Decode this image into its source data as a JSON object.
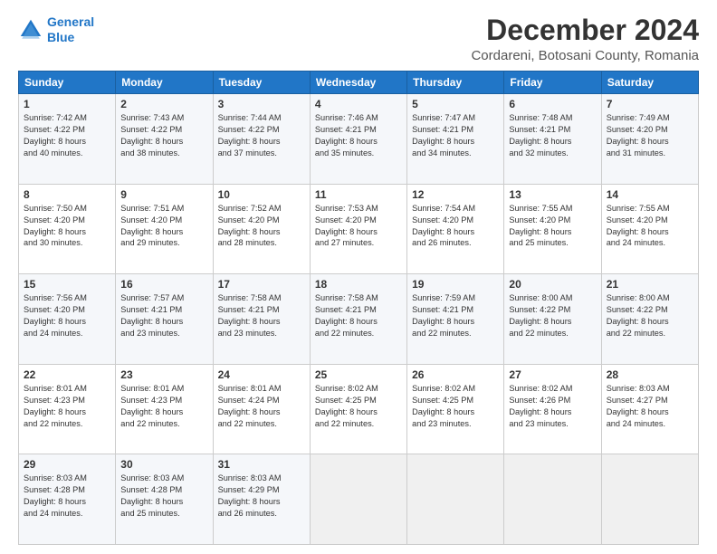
{
  "logo": {
    "line1": "General",
    "line2": "Blue"
  },
  "title": "December 2024",
  "subtitle": "Cordareni, Botosani County, Romania",
  "headers": [
    "Sunday",
    "Monday",
    "Tuesday",
    "Wednesday",
    "Thursday",
    "Friday",
    "Saturday"
  ],
  "weeks": [
    [
      {
        "day": "1",
        "info": "Sunrise: 7:42 AM\nSunset: 4:22 PM\nDaylight: 8 hours\nand 40 minutes."
      },
      {
        "day": "2",
        "info": "Sunrise: 7:43 AM\nSunset: 4:22 PM\nDaylight: 8 hours\nand 38 minutes."
      },
      {
        "day": "3",
        "info": "Sunrise: 7:44 AM\nSunset: 4:22 PM\nDaylight: 8 hours\nand 37 minutes."
      },
      {
        "day": "4",
        "info": "Sunrise: 7:46 AM\nSunset: 4:21 PM\nDaylight: 8 hours\nand 35 minutes."
      },
      {
        "day": "5",
        "info": "Sunrise: 7:47 AM\nSunset: 4:21 PM\nDaylight: 8 hours\nand 34 minutes."
      },
      {
        "day": "6",
        "info": "Sunrise: 7:48 AM\nSunset: 4:21 PM\nDaylight: 8 hours\nand 32 minutes."
      },
      {
        "day": "7",
        "info": "Sunrise: 7:49 AM\nSunset: 4:20 PM\nDaylight: 8 hours\nand 31 minutes."
      }
    ],
    [
      {
        "day": "8",
        "info": "Sunrise: 7:50 AM\nSunset: 4:20 PM\nDaylight: 8 hours\nand 30 minutes."
      },
      {
        "day": "9",
        "info": "Sunrise: 7:51 AM\nSunset: 4:20 PM\nDaylight: 8 hours\nand 29 minutes."
      },
      {
        "day": "10",
        "info": "Sunrise: 7:52 AM\nSunset: 4:20 PM\nDaylight: 8 hours\nand 28 minutes."
      },
      {
        "day": "11",
        "info": "Sunrise: 7:53 AM\nSunset: 4:20 PM\nDaylight: 8 hours\nand 27 minutes."
      },
      {
        "day": "12",
        "info": "Sunrise: 7:54 AM\nSunset: 4:20 PM\nDaylight: 8 hours\nand 26 minutes."
      },
      {
        "day": "13",
        "info": "Sunrise: 7:55 AM\nSunset: 4:20 PM\nDaylight: 8 hours\nand 25 minutes."
      },
      {
        "day": "14",
        "info": "Sunrise: 7:55 AM\nSunset: 4:20 PM\nDaylight: 8 hours\nand 24 minutes."
      }
    ],
    [
      {
        "day": "15",
        "info": "Sunrise: 7:56 AM\nSunset: 4:20 PM\nDaylight: 8 hours\nand 24 minutes."
      },
      {
        "day": "16",
        "info": "Sunrise: 7:57 AM\nSunset: 4:21 PM\nDaylight: 8 hours\nand 23 minutes."
      },
      {
        "day": "17",
        "info": "Sunrise: 7:58 AM\nSunset: 4:21 PM\nDaylight: 8 hours\nand 23 minutes."
      },
      {
        "day": "18",
        "info": "Sunrise: 7:58 AM\nSunset: 4:21 PM\nDaylight: 8 hours\nand 22 minutes."
      },
      {
        "day": "19",
        "info": "Sunrise: 7:59 AM\nSunset: 4:21 PM\nDaylight: 8 hours\nand 22 minutes."
      },
      {
        "day": "20",
        "info": "Sunrise: 8:00 AM\nSunset: 4:22 PM\nDaylight: 8 hours\nand 22 minutes."
      },
      {
        "day": "21",
        "info": "Sunrise: 8:00 AM\nSunset: 4:22 PM\nDaylight: 8 hours\nand 22 minutes."
      }
    ],
    [
      {
        "day": "22",
        "info": "Sunrise: 8:01 AM\nSunset: 4:23 PM\nDaylight: 8 hours\nand 22 minutes."
      },
      {
        "day": "23",
        "info": "Sunrise: 8:01 AM\nSunset: 4:23 PM\nDaylight: 8 hours\nand 22 minutes."
      },
      {
        "day": "24",
        "info": "Sunrise: 8:01 AM\nSunset: 4:24 PM\nDaylight: 8 hours\nand 22 minutes."
      },
      {
        "day": "25",
        "info": "Sunrise: 8:02 AM\nSunset: 4:25 PM\nDaylight: 8 hours\nand 22 minutes."
      },
      {
        "day": "26",
        "info": "Sunrise: 8:02 AM\nSunset: 4:25 PM\nDaylight: 8 hours\nand 23 minutes."
      },
      {
        "day": "27",
        "info": "Sunrise: 8:02 AM\nSunset: 4:26 PM\nDaylight: 8 hours\nand 23 minutes."
      },
      {
        "day": "28",
        "info": "Sunrise: 8:03 AM\nSunset: 4:27 PM\nDaylight: 8 hours\nand 24 minutes."
      }
    ],
    [
      {
        "day": "29",
        "info": "Sunrise: 8:03 AM\nSunset: 4:28 PM\nDaylight: 8 hours\nand 24 minutes."
      },
      {
        "day": "30",
        "info": "Sunrise: 8:03 AM\nSunset: 4:28 PM\nDaylight: 8 hours\nand 25 minutes."
      },
      {
        "day": "31",
        "info": "Sunrise: 8:03 AM\nSunset: 4:29 PM\nDaylight: 8 hours\nand 26 minutes."
      },
      null,
      null,
      null,
      null
    ]
  ]
}
